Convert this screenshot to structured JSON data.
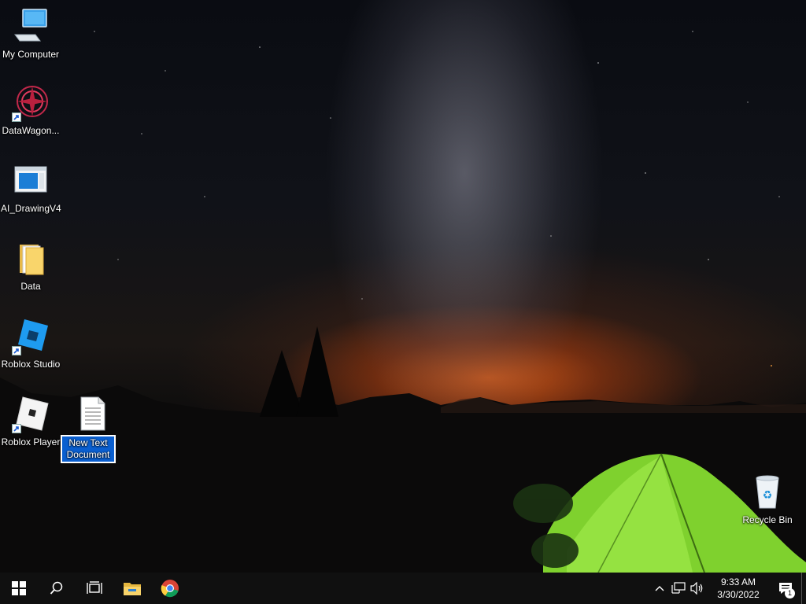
{
  "desktop": {
    "icons": [
      {
        "label": "My Computer"
      },
      {
        "label": "DataWagon..."
      },
      {
        "label": "AI_DrawingV4"
      },
      {
        "label": "Data"
      },
      {
        "label": "Roblox Studio"
      },
      {
        "label": "Roblox Player"
      },
      {
        "label": "New Text Document",
        "selected": true
      },
      {
        "label": "Recycle Bin"
      }
    ]
  },
  "taskbar": {
    "buttons": [
      {
        "icon": "windows-start-icon"
      },
      {
        "icon": "search-icon"
      },
      {
        "icon": "task-view-icon"
      },
      {
        "icon": "file-explorer-icon"
      },
      {
        "icon": "chrome-icon"
      }
    ],
    "tray": {
      "time": "9:33 AM",
      "date": "3/30/2022",
      "notification_count": "1"
    }
  },
  "colors": {
    "taskbar": "#101010",
    "selection": "#0a5fd0",
    "tent": "#8ee03a"
  }
}
